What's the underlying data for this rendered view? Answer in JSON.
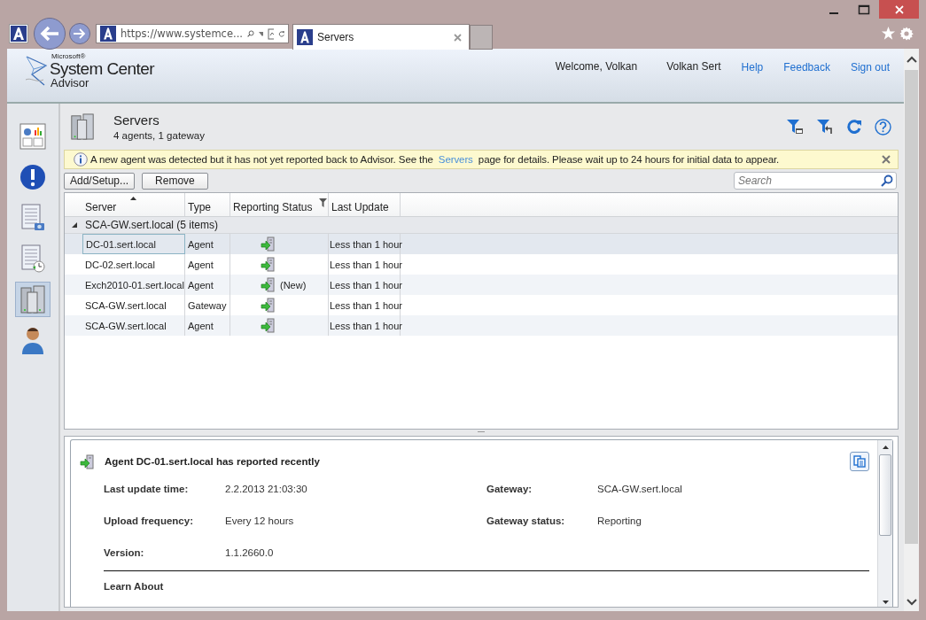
{
  "browser": {
    "address": "https://www.systemce...",
    "tab_title": "Servers"
  },
  "header": {
    "logo_small": "Microsoft®",
    "logo_main": "System Center",
    "logo_sub": "Advisor",
    "welcome": "Welcome, Volkan",
    "user": "Volkan Sert",
    "links": [
      "Help",
      "Feedback",
      "Sign out"
    ]
  },
  "nav": [
    {
      "kind": "dashboard",
      "selected": false
    },
    {
      "kind": "alerts",
      "selected": false
    },
    {
      "kind": "configuration",
      "selected": false
    },
    {
      "kind": "history",
      "selected": false
    },
    {
      "kind": "servers",
      "selected": true
    },
    {
      "kind": "account",
      "selected": false
    }
  ],
  "page": {
    "title": "Servers",
    "subtitle": "4 agents, 1 gateway"
  },
  "banner": {
    "before": "A new agent was detected but it has not yet reported back to Advisor. See the",
    "link": "Servers",
    "after": "page for details. Please wait up to 24 hours for initial data to appear."
  },
  "buttons": [
    "Add/Setup...",
    "Remove"
  ],
  "search": {
    "placeholder": "Search"
  },
  "table": {
    "columns": [
      {
        "label": "Server",
        "sorted": true,
        "filter": false
      },
      {
        "label": "Type",
        "sorted": false,
        "filter": false
      },
      {
        "label": "Reporting Status",
        "sorted": false,
        "filter": true
      },
      {
        "label": "Last Update",
        "sorted": false,
        "filter": false
      }
    ],
    "group": {
      "label": "SCA-GW.sert.local (5 items)",
      "expanded": true
    },
    "rows": [
      {
        "server": "DC-01.sert.local",
        "type": "Agent",
        "note": "",
        "last_update": "Less than 1 hour",
        "selected": true
      },
      {
        "server": "DC-02.sert.local",
        "type": "Agent",
        "note": "",
        "last_update": "Less than 1 hour",
        "selected": false
      },
      {
        "server": "Exch2010-01.sert.local",
        "type": "Agent",
        "note": "(New)",
        "last_update": "Less than 1 hour",
        "selected": false
      },
      {
        "server": "SCA-GW.sert.local",
        "type": "Gateway",
        "note": "",
        "last_update": "Less than 1 hour",
        "selected": false
      },
      {
        "server": "SCA-GW.sert.local",
        "type": "Agent",
        "note": "",
        "last_update": "Less than 1 hour",
        "selected": false
      }
    ]
  },
  "details": {
    "title": "Agent DC-01.sert.local has reported recently",
    "left": [
      {
        "label": "Last update time:",
        "value": "2.2.2013 21:03:30"
      },
      {
        "label": "Upload frequency:",
        "value": "Every 12 hours"
      },
      {
        "label": "Version:",
        "value": "1.1.2660.0"
      }
    ],
    "right": [
      {
        "label": "Gateway:",
        "value": "SCA-GW.sert.local"
      },
      {
        "label": "Gateway status:",
        "value": "Reporting"
      }
    ],
    "section": "Learn About"
  }
}
